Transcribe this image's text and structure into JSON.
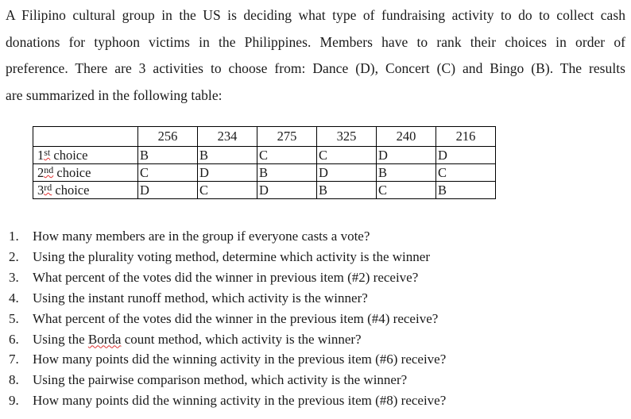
{
  "intro": {
    "lines": [
      "A Filipino cultural group in the US is deciding what type of fundraising activity to do to collect cash",
      "donations for typhoon victims in the Philippines. Members have to rank their choices in order of",
      "preference. There are 3 activities to choose from: Dance (D), Concert (C) and Bingo (B). The results",
      "are summarized in the following table:"
    ]
  },
  "table": {
    "voter_counts": [
      "256",
      "234",
      "275",
      "325",
      "240",
      "216"
    ],
    "rows": [
      {
        "ordinal": "1",
        "suffix": "st",
        "label": "choice",
        "cells": [
          "B",
          "B",
          "C",
          "C",
          "D",
          "D"
        ]
      },
      {
        "ordinal": "2",
        "suffix": "nd",
        "label": "choice",
        "cells": [
          "C",
          "D",
          "B",
          "D",
          "B",
          "C"
        ]
      },
      {
        "ordinal": "3",
        "suffix": "rd",
        "label": "choice",
        "cells": [
          "D",
          "C",
          "D",
          "B",
          "C",
          "B"
        ]
      }
    ]
  },
  "questions": [
    {
      "num": "1.",
      "text": "How many members are in the group if everyone casts a vote?"
    },
    {
      "num": "2.",
      "text": "Using the plurality voting method, determine which activity is the winner"
    },
    {
      "num": "3.",
      "text": "What percent of the votes did the winner in previous item (#2) receive?"
    },
    {
      "num": "4.",
      "text": "Using the instant runoff method, which activity is the winner?"
    },
    {
      "num": "5.",
      "text": "What percent of the votes did the winner in the previous item (#4) receive?"
    },
    {
      "num": "6.",
      "pre": "Using the ",
      "flagged": "Borda",
      "post": " count method, which activity is the winner?"
    },
    {
      "num": "7.",
      "text": "How many points did the winning activity in the previous item (#6) receive?"
    },
    {
      "num": "8.",
      "text": "Using the pairwise comparison method, which activity is the winner?"
    },
    {
      "num": "9.",
      "text": "How many points did the winning activity in the previous item (#8) receive?"
    }
  ]
}
